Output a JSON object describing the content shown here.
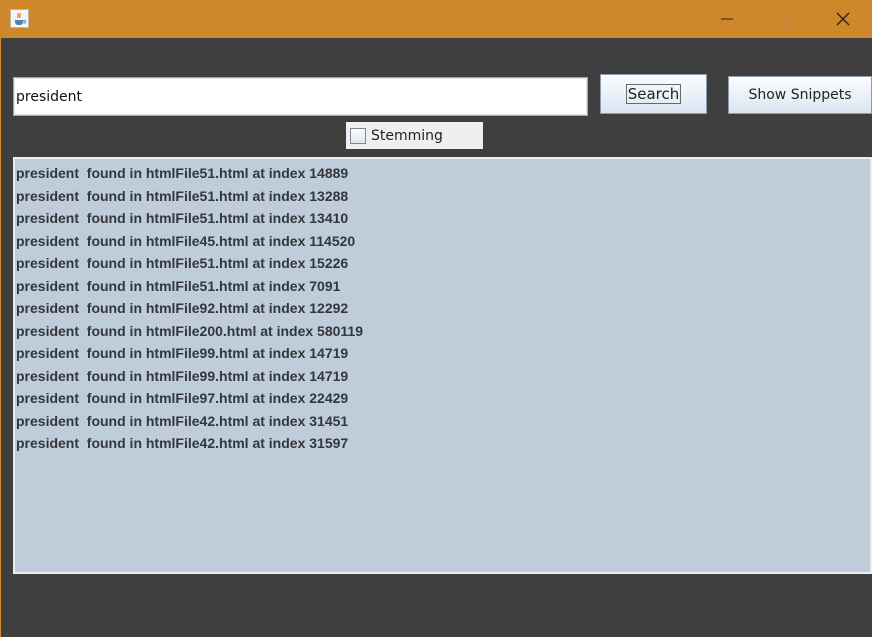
{
  "window": {
    "icon": "java-cup-icon",
    "controls": [
      "minimize-icon",
      "maximize-icon",
      "close-icon"
    ],
    "titlebar_color": "#cf8829"
  },
  "search": {
    "value": "president",
    "button_label": "Search"
  },
  "snippets_button_label": "Show Snippets",
  "stemming": {
    "label": "Stemming",
    "checked": false
  },
  "results": [
    "president  found in htmlFile51.html at index 14889",
    "president  found in htmlFile51.html at index 13288",
    "president  found in htmlFile51.html at index 13410",
    "president  found in htmlFile45.html at index 114520",
    "president  found in htmlFile51.html at index 15226",
    "president  found in htmlFile51.html at index 7091",
    "president  found in htmlFile92.html at index 12292",
    "president  found in htmlFile200.html at index 580119",
    "president  found in htmlFile99.html at index 14719",
    "president  found in htmlFile99.html at index 14719",
    "president  found in htmlFile97.html at index 22429",
    "president  found in htmlFile42.html at index 31451",
    "president  found in htmlFile42.html at index 31597"
  ]
}
